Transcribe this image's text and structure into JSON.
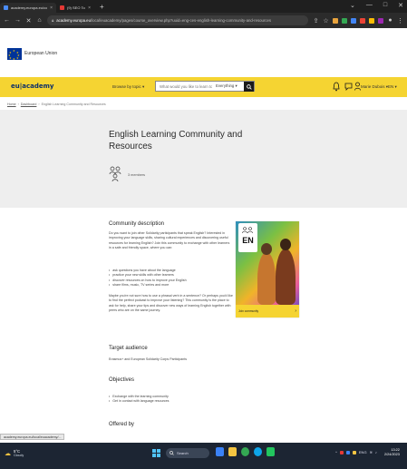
{
  "browser": {
    "tabs": [
      {
        "label": "academy.europa.eu/courses/...",
        "active": true,
        "color": "#4a8cf7"
      },
      {
        "label": "(9) SEO Tools",
        "active": false,
        "color": "#e53935"
      }
    ],
    "new_tab": "+",
    "window_controls": [
      "⌄",
      "—",
      "□",
      "✕"
    ],
    "url_host": "academy.europa.eu",
    "url_path": "/local/euacademy/pages/course_overview.php?uuid=eng-ces-english-learning-community-and-resources"
  },
  "eu_header": {
    "label": "European Union",
    "flag_color": "#003399",
    "star_color": "#ffcc00"
  },
  "nav": {
    "logo": "eu|academy",
    "browse_label": "Browse by topic ▾",
    "search_placeholder": "What would you like to learn today?",
    "search_scope": "Everything ▾",
    "user_name": "Marie Dubois ▾",
    "language": "EN ▾",
    "bar_color": "#f5d432",
    "icons": [
      "search-icon",
      "bell-icon",
      "chat-icon",
      "user-icon"
    ]
  },
  "breadcrumb": [
    "Home",
    "Dashboard",
    "English Learning Community and Resources"
  ],
  "hero": {
    "title": "English Learning Community and Resources",
    "members": "3 members"
  },
  "content": {
    "community_heading": "Community description",
    "community_text": "Do you want to join other Solidarity participants that speak English? Interested in improving your language skills, sharing cultural experiences and discovering useful resources for learning English? Join this community to exchange with other learners in a safe and friendly space, where you can:",
    "bullets": [
      "ask questions you have about the language",
      "practice your new skills with other learners",
      "discover resources on how to improve your English",
      "share films, music, TV series and more"
    ],
    "more_text": "Maybe you're not sure how to use a phrasal verb in a sentence? Or perhaps you'd like to find the perfect podcast to improve your listening? This community is the place to ask for help, share your tips and discover new ways of learning English together with peers who are on the same journey.",
    "target_heading": "Target audience",
    "target_text": "Erasmus+ and European Solidarity Corps Participants",
    "objectives_heading": "Objectives",
    "objectives": [
      "Exchange with the learning community",
      "Get in contact with language resources"
    ],
    "offered_heading": "Offered by"
  },
  "card": {
    "badge": "EN",
    "footer": "Join community",
    "arrow": "›"
  },
  "status_url": "academy.europa.eu/local/euacademy/...",
  "taskbar": {
    "temp": "5°C",
    "condition": "Cloudy",
    "search": "Search",
    "time": "13:22",
    "date": "2/24/2023",
    "tray": "ENG"
  }
}
